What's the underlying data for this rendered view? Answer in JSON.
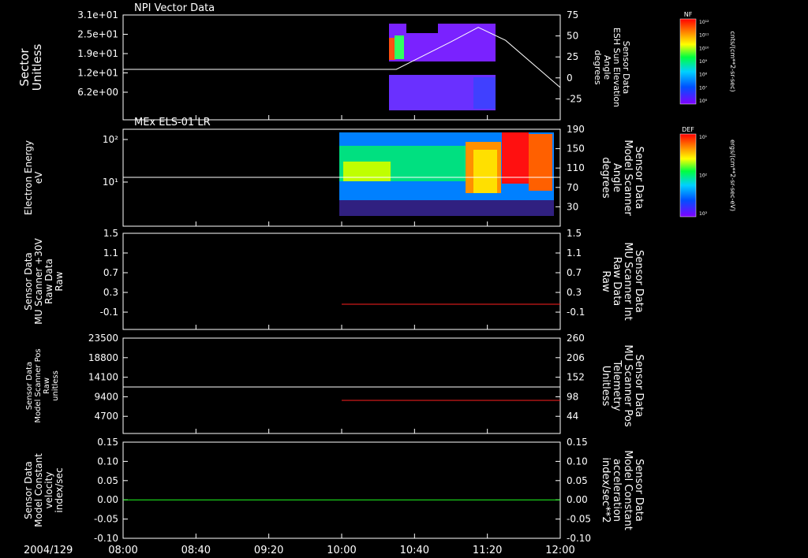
{
  "chart_data": [
    {
      "type": "heatmap",
      "title": "NPI Vector Data",
      "ylabel": [
        "Sector",
        "Unitless"
      ],
      "y_ticks": [
        "3.1e+01",
        "2.5e+01",
        "1.9e+01",
        "1.2e+01",
        "6.2e+00"
      ],
      "right_ylabel": [
        "Sensor Data",
        "ESH Sun Elevation",
        "Angle",
        "degrees"
      ],
      "right_ticks": [
        "75",
        "50",
        "25",
        "0",
        "-25"
      ],
      "right_ylim": [
        -50,
        75
      ],
      "overlay_line": {
        "name": "Sun Elevation",
        "color": "#ffffff",
        "x": [
          "08:00",
          "10:00",
          "10:30",
          "11:00",
          "11:15",
          "11:30",
          "12:00"
        ],
        "y": [
          0,
          0,
          0,
          38,
          58,
          40,
          -25
        ]
      },
      "colorbar": {
        "label": "NF",
        "unit": "cnts/(cm**2-sr-sec)",
        "ticks": [
          "10¹²",
          "10¹¹",
          "10¹⁰",
          "10⁹",
          "10⁸",
          "10⁷",
          "10⁶"
        ]
      }
    },
    {
      "type": "heatmap",
      "title": "MEx ELS-01 LR",
      "ylabel": [
        "Electron Energy",
        "eV"
      ],
      "y_ticks": [
        "10²",
        "10¹"
      ],
      "right_ylabel": [
        "Sensor Data",
        "Model Scanner",
        "Angle",
        "degrees"
      ],
      "right_ticks": [
        "190",
        "150",
        "110",
        "70",
        "30"
      ],
      "right_ylim": [
        -10,
        190
      ],
      "overlay_line": {
        "name": "Scanner Angle",
        "color": "#ffffff",
        "x": [
          "08:00",
          "12:00"
        ],
        "y": [
          90,
          90
        ]
      },
      "colorbar": {
        "label": "DEF",
        "unit": "ergs/(cm**2-sr-sec-eV)",
        "ticks": [
          "10¹",
          "10²",
          "10³"
        ]
      }
    },
    {
      "type": "line",
      "ylabel": [
        "Sensor Data",
        "MU Scanner +30V",
        "Raw Data",
        "Raw"
      ],
      "y_ticks": [
        "1.5",
        "1.1",
        "0.7",
        "0.3",
        "-0.1"
      ],
      "ylim": [
        -0.5,
        1.5
      ],
      "right_ylabel": [
        "Sensor Data",
        "MU Scanner Int",
        "Raw Data",
        "Raw"
      ],
      "right_ticks": [
        "1.5",
        "1.1",
        "0.7",
        "0.3",
        "-0.1"
      ],
      "series": [
        {
          "color": "#ff2020",
          "x": [
            "10:00",
            "12:00"
          ],
          "y": [
            0.05,
            0.05
          ]
        }
      ]
    },
    {
      "type": "line",
      "ylabel": [
        "Sensor Data",
        "Model Scanner Pos",
        "Raw",
        "unitless"
      ],
      "y_ticks": [
        "23500",
        "18800",
        "14100",
        "9400",
        "4700"
      ],
      "ylim": [
        0,
        23500
      ],
      "right_ylabel": [
        "Sensor Data",
        "MU Scanner Pos",
        "Telemetry",
        "Unitless"
      ],
      "right_ticks": [
        "260",
        "206",
        "152",
        "98",
        "44"
      ],
      "right_ylim": [
        -10,
        260
      ],
      "series": [
        {
          "color": "#ffffff",
          "x": [
            "08:00",
            "12:00"
          ],
          "y": [
            11800,
            11800
          ]
        },
        {
          "color": "#ff2020",
          "axis": "right",
          "x": [
            "10:00",
            "12:00"
          ],
          "y": [
            90,
            90
          ]
        }
      ]
    },
    {
      "type": "line",
      "ylabel": [
        "Sensor Data",
        "Model Constant",
        "velocity",
        "index/sec"
      ],
      "y_ticks": [
        "0.15",
        "0.10",
        "0.05",
        "0.00",
        "-0.05",
        "-0.10"
      ],
      "ylim": [
        -0.1,
        0.15
      ],
      "right_ylabel": [
        "Sensor Data",
        "Model Constant",
        "acceleration",
        "index/sec**2"
      ],
      "right_ticks": [
        "0.15",
        "0.10",
        "0.05",
        "0.00",
        "-0.05",
        "-0.10"
      ],
      "series": [
        {
          "color": "#20ff20",
          "x": [
            "08:00",
            "12:00"
          ],
          "y": [
            0.0,
            0.0
          ]
        }
      ]
    }
  ],
  "time_axis": {
    "date_label": "2004/129",
    "ticks": [
      "08:00",
      "08:40",
      "09:20",
      "10:00",
      "10:40",
      "11:20",
      "12:00"
    ],
    "start": "08:00",
    "end": "12:00"
  }
}
